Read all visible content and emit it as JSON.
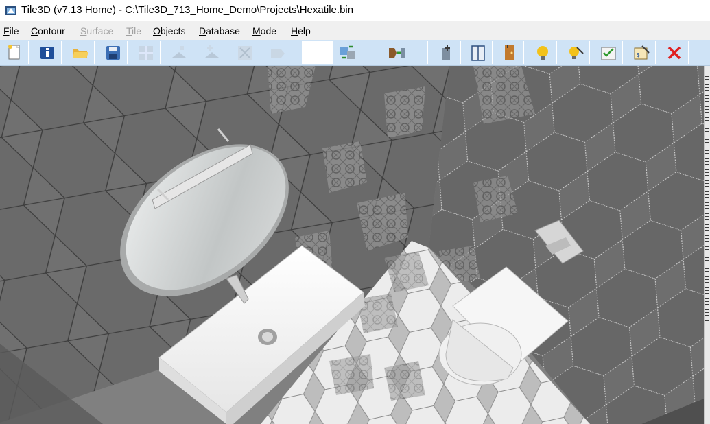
{
  "window": {
    "title": "Tile3D (v7.13 Home) - C:\\Tile3D_713_Home_Demo\\Projects\\Hexatile.bin"
  },
  "menu": [
    {
      "label": "File",
      "accel": "F",
      "rest": "ile",
      "enabled": true
    },
    {
      "label": "Contour",
      "accel": "C",
      "rest": "ontour",
      "enabled": true
    },
    {
      "label": "Surface",
      "accel": "S",
      "rest": "urface",
      "enabled": false
    },
    {
      "label": "Tile",
      "accel": "T",
      "rest": "ile",
      "enabled": false
    },
    {
      "label": "Objects",
      "accel": "O",
      "rest": "bjects",
      "enabled": true
    },
    {
      "label": "Database",
      "accel": "D",
      "rest": "atabase",
      "enabled": true
    },
    {
      "label": "Mode",
      "accel": "M",
      "rest": "ode",
      "enabled": true
    },
    {
      "label": "Help",
      "accel": "H",
      "rest": "elp",
      "enabled": true
    }
  ],
  "toolbar": {
    "buttons": [
      {
        "icon": "new-project-icon",
        "enabled": true
      },
      {
        "icon": "info-icon",
        "enabled": true
      },
      {
        "icon": "open-folder-icon",
        "enabled": true
      },
      {
        "icon": "save-icon",
        "enabled": true
      },
      {
        "icon": "tile-grid-icon",
        "enabled": false
      },
      {
        "icon": "add-surface-icon",
        "enabled": false
      },
      {
        "icon": "edit-surface-icon",
        "enabled": false
      },
      {
        "icon": "delete-surface-icon",
        "enabled": false
      },
      {
        "icon": "surface-shape-icon",
        "enabled": false
      },
      {
        "icon": "swap-view-icon",
        "enabled": true
      },
      {
        "icon": "contour-to-room-icon",
        "enabled": true
      },
      {
        "icon": "add-object-icon",
        "enabled": true
      },
      {
        "icon": "cabinet-icon",
        "enabled": true
      },
      {
        "icon": "door-icon",
        "enabled": true
      },
      {
        "icon": "light-bulb-icon",
        "enabled": true
      },
      {
        "icon": "light-edit-icon",
        "enabled": true
      },
      {
        "icon": "checklist-icon",
        "enabled": true
      },
      {
        "icon": "cost-estimate-icon",
        "enabled": true
      },
      {
        "icon": "close-icon",
        "enabled": true
      }
    ]
  },
  "scene": {
    "wall_tile_color": "#6f6f6f",
    "floor_tile_color": "#e9e9e9",
    "decor_tile_color": "#8a8a8a"
  }
}
